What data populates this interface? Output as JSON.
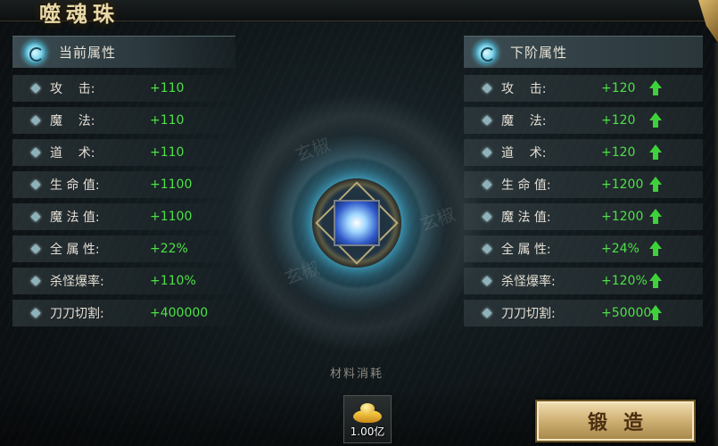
{
  "window": {
    "title": "噬魂珠"
  },
  "current": {
    "title": "当前属性",
    "rows": [
      {
        "label": "攻    击:",
        "value": "+110"
      },
      {
        "label": "魔    法:",
        "value": "+110"
      },
      {
        "label": "道    术:",
        "value": "+110"
      },
      {
        "label": "生 命 值:",
        "value": "+1100"
      },
      {
        "label": "魔 法 值:",
        "value": "+1100"
      },
      {
        "label": "全 属 性:",
        "value": "+22%"
      },
      {
        "label": "杀怪爆率:",
        "value": "+110%"
      },
      {
        "label": "刀刀切割:",
        "value": "+400000"
      }
    ]
  },
  "next": {
    "title": "下阶属性",
    "rows": [
      {
        "label": "攻    击:",
        "value": "+120"
      },
      {
        "label": "魔    法:",
        "value": "+120"
      },
      {
        "label": "道    术:",
        "value": "+120"
      },
      {
        "label": "生 命 值:",
        "value": "+1200"
      },
      {
        "label": "魔 法 值:",
        "value": "+1200"
      },
      {
        "label": "全 属 性:",
        "value": "+24%"
      },
      {
        "label": "杀怪爆率:",
        "value": "+120%"
      },
      {
        "label": "刀刀切割:",
        "value": "+500000"
      }
    ]
  },
  "watermark": {
    "text": "玄椒"
  },
  "material": {
    "title": "材料消耗",
    "amount": "1.00亿",
    "icon": "gold-ingot-icon"
  },
  "forge_button": {
    "label": "锻造"
  },
  "colors": {
    "value_green": "#4ee047",
    "arrow_green": "#3fd13b",
    "button_gold": "#d2b478"
  }
}
